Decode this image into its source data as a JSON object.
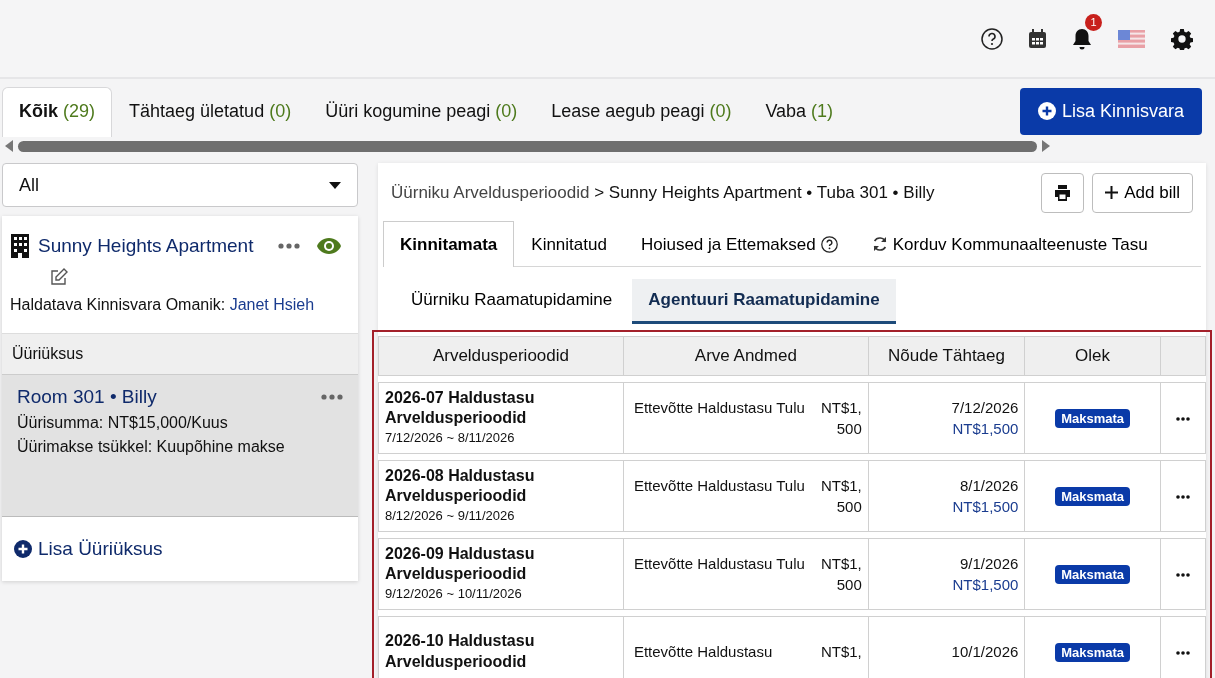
{
  "header": {
    "notification_count": "1"
  },
  "filter_tabs": [
    {
      "label": "Kõik",
      "count": "(29)",
      "selected": true
    },
    {
      "label": "Tähtaeg ületatud",
      "count": "(0)",
      "selected": false
    },
    {
      "label": "Üüri kogumine peagi",
      "count": "(0)",
      "selected": false
    },
    {
      "label": "Lease aegub peagi",
      "count": "(0)",
      "selected": false
    },
    {
      "label": "Vaba",
      "count": "(1)",
      "selected": false
    }
  ],
  "add_property_button": "Lisa Kinnisvara",
  "filter_select": {
    "value": "All"
  },
  "property": {
    "name": "Sunny Heights Apartment",
    "owner_label": "Haldatava Kinnisvara Omanik:",
    "owner": "Janet Hsieh",
    "visible": true
  },
  "units_heading": "Üüriüksus",
  "units": [
    {
      "title": "Room 301 • Billy",
      "rent": "Üürisumma: NT$15,000/Kuus",
      "cycle": "Üürimakse tsükkel: Kuupõhine makse",
      "selected": true
    }
  ],
  "add_unit_link": "Lisa Üüriüksus",
  "breadcrumb": {
    "root": "Üürniku Arveldusperioodid",
    "separator": ">",
    "current": "Sunny Heights Apartment • Tuba 301 • Billy"
  },
  "add_bill_button": "Add bill",
  "bill_tabs": [
    {
      "label": "Kinnitamata",
      "kind": "plain",
      "selected": true
    },
    {
      "label": "Kinnitatud",
      "kind": "plain",
      "selected": false
    },
    {
      "label": "Hoiused ja Ettemaksed",
      "kind": "help",
      "selected": false
    },
    {
      "label": "Korduv Kommunaalteenuste Tasu",
      "kind": "recurring",
      "selected": false
    }
  ],
  "ledger_tabs": [
    {
      "label": "Üürniku Raamatupidamine",
      "selected": false
    },
    {
      "label": "Agentuuri Raamatupidamine",
      "selected": true
    }
  ],
  "table": {
    "columns": [
      "Arveldusperioodid",
      "Arve Andmed",
      "Nõude Tähtaeg",
      "Olek"
    ],
    "rows": [
      {
        "period": "2026-07 Haldustasu Arveldusperioodid",
        "range": "7/12/2026 ~ 8/11/2026",
        "item": "Ettevõtte Haldustasu Tulu",
        "amount": "NT$1,500",
        "due_date": "7/12/2026",
        "due_amount": "NT$1,500",
        "status": "Maksmata"
      },
      {
        "period": "2026-08 Haldustasu Arveldusperioodid",
        "range": "8/12/2026 ~ 9/11/2026",
        "item": "Ettevõtte Haldustasu Tulu",
        "amount": "NT$1,500",
        "due_date": "8/1/2026",
        "due_amount": "NT$1,500",
        "status": "Maksmata"
      },
      {
        "period": "2026-09 Haldustasu Arveldusperioodid",
        "range": "9/12/2026 ~ 10/11/2026",
        "item": "Ettevõtte Haldustasu Tulu",
        "amount": "NT$1,500",
        "due_date": "9/1/2026",
        "due_amount": "NT$1,500",
        "status": "Maksmata"
      },
      {
        "period": "2026-10 Haldustasu Arveldusperioodid",
        "item": "Ettevõtte Haldustasu",
        "amount": "NT$1,",
        "due_date": "10/1/2026",
        "status": "Maksmata"
      }
    ]
  }
}
